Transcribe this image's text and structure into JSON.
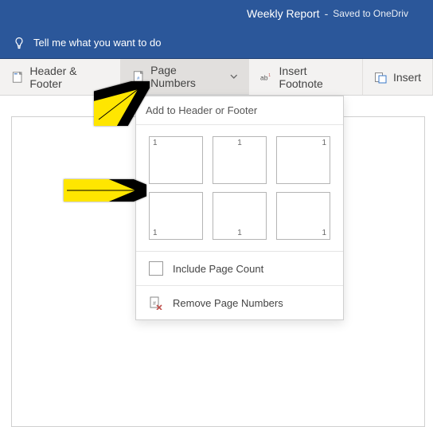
{
  "titlebar": {
    "title": "Weekly Report",
    "separator": "-",
    "saved": "Saved to OneDriv"
  },
  "tellme": {
    "placeholder": "Tell me what you want to do"
  },
  "ribbon": {
    "header_footer": "Header & Footer",
    "page_numbers": "Page Numbers",
    "insert_footnote": "Insert Footnote",
    "insert": "Insert"
  },
  "dropdown": {
    "header": "Add to Header or Footer",
    "sample_num": "1",
    "include_page_count": "Include Page Count",
    "remove_page_numbers": "Remove Page Numbers"
  }
}
